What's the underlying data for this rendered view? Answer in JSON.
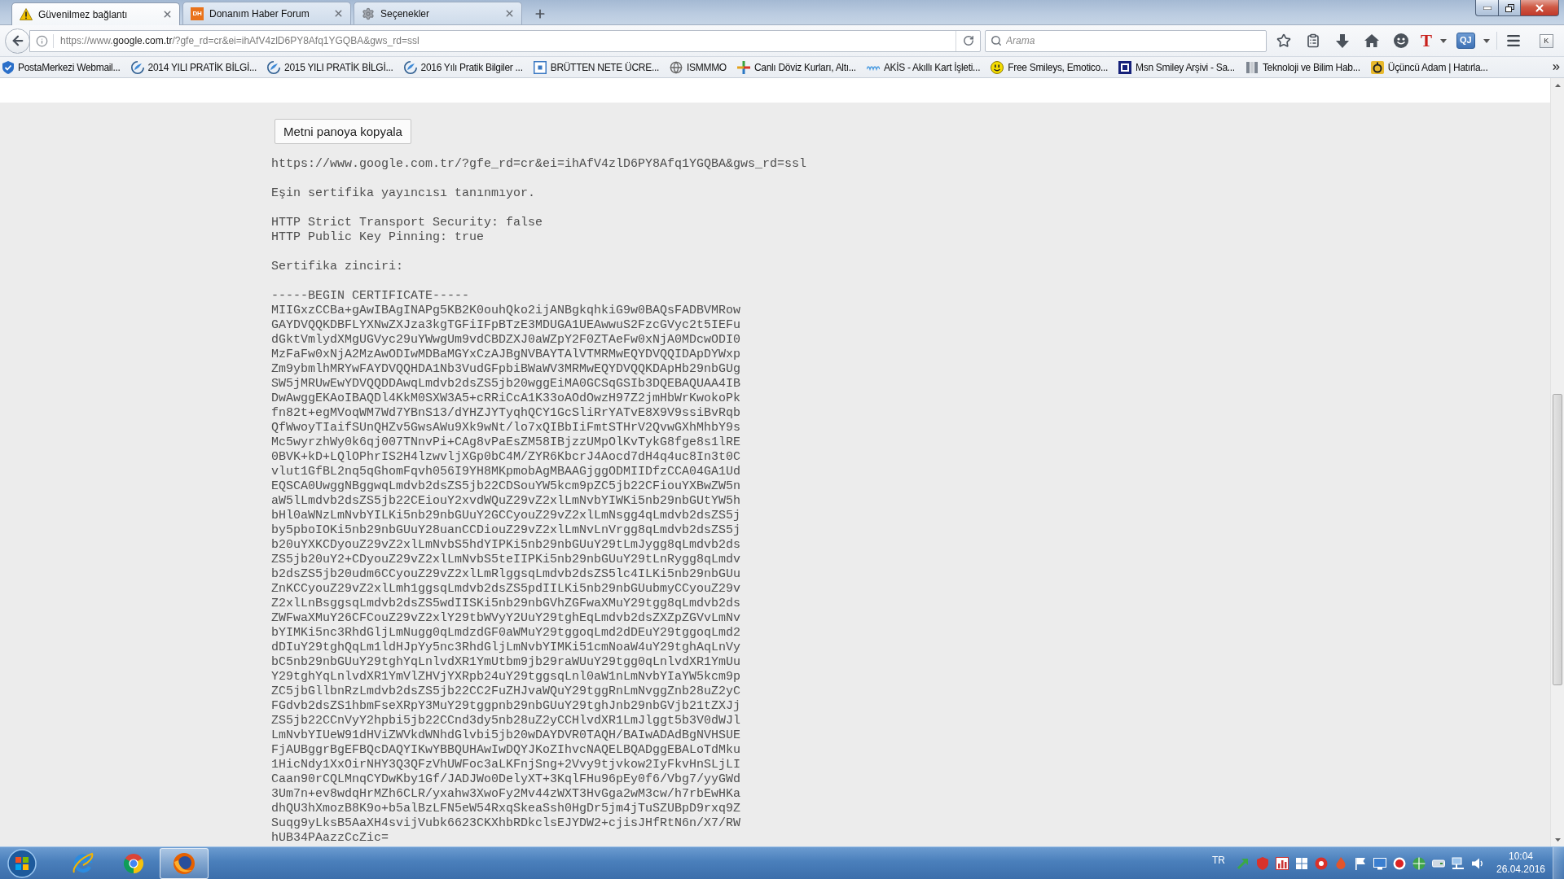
{
  "tabs": [
    {
      "title": "Güvenilmez bağlantı",
      "selected": true,
      "kind": "warning"
    },
    {
      "title": "Donanım Haber Forum",
      "selected": false,
      "kind": "logo",
      "logo_text": "DH"
    },
    {
      "title": "Seçenekler",
      "selected": false,
      "kind": "gear"
    }
  ],
  "address_bar": {
    "url_prefix": "https://www.",
    "url_domain": "google.com.tr",
    "url_path": "/?gfe_rd=cr&ei=ihAfV4zlD6PY8Afq1YGQBA&gws_rd=ssl"
  },
  "search": {
    "placeholder": "Arama"
  },
  "toolbar": {
    "extensions": [
      {
        "kind": "serif",
        "text": "T",
        "menu": true
      },
      {
        "kind": "badge",
        "text": "QJ",
        "menu": true
      }
    ],
    "panel_button": {
      "text": "K"
    }
  },
  "bookmarks": [
    {
      "label": "PostaMerkezi Webmail...",
      "kind": "shield"
    },
    {
      "label": "2014 YILI PRATİK BİLGİ...",
      "kind": "swirl"
    },
    {
      "label": "2015 YILI PRATİK BİLGİ...",
      "kind": "swirl"
    },
    {
      "label": "2016 Yılı Pratik Bilgiler ...",
      "kind": "swirl"
    },
    {
      "label": "BRÜTTEN NETE ÜCRE...",
      "kind": "frame"
    },
    {
      "label": "ISMMMO",
      "kind": "globe"
    },
    {
      "label": "Canlı Döviz Kurları, Altı...",
      "kind": "cross"
    },
    {
      "label": "AKİS - Akıllı Kart İşleti...",
      "kind": "wordmark"
    },
    {
      "label": "Free Smileys, Emotico...",
      "kind": "smiley"
    },
    {
      "label": "Msn Smiley Arşivi - Sa...",
      "kind": "tile"
    },
    {
      "label": "Teknoloji ve Bilim Hab...",
      "kind": "figure"
    },
    {
      "label": "Üçüncü Adam | Hatırla...",
      "kind": "ring"
    }
  ],
  "page": {
    "copy_button": "Metni panoya kopyala",
    "url": "https://www.google.com.tr/?gfe_rd=cr&ei=ihAfV4zlD6PY8Afq1YGQBA&gws_rd=ssl",
    "error": "Eşin sertifika yayıncısı tanınmıyor.",
    "security": [
      "HTTP Strict Transport Security: false",
      "HTTP Public Key Pinning: true"
    ],
    "chain_label": "Sertifika zinciri:",
    "certificate": {
      "begin": "-----BEGIN CERTIFICATE-----",
      "lines": [
        "MIIGxzCCBa+gAwIBAgINAPg5KB2K0ouhQko2ijANBgkqhkiG9w0BAQsFADBVMRow",
        "GAYDVQQKDBFLYXNwZXJza3kgTGFiIFpBTzE3MDUGA1UEAwwuS2FzcGVyc2t5IEFu",
        "dGktVmlydXMgUGVyc29uYWwgUm9vdCBDZXJ0aWZpY2F0ZTAeFw0xNjA0MDcwODI0",
        "MzFaFw0xNjA2MzAwODIwMDBaMGYxCzAJBgNVBAYTAlVTMRMwEQYDVQQIDApDYWxp",
        "Zm9ybmlhMRYwFAYDVQQHDA1Nb3VudGFpbiBWaWV3MRMwEQYDVQQKDApHb29nbGUg",
        "SW5jMRUwEwYDVQQDDAwqLmdvb2dsZS5jb20wggEiMA0GCSqGSIb3DQEBAQUAA4IB",
        "DwAwggEKAoIBAQDl4KkM0SXW3A5+cRRiCcA1K33oAOdOwzH97Z2jmHbWrKwokoPk",
        "fn82t+egMVoqWM7Wd7YBnS13/dYHZJYTyqhQCY1GcSliRrYATvE8X9V9ssiBvRqb",
        "QfWwoyTIaifSUnQHZv5GwsAWu9Xk9wNt/lo7xQIBbIiFmtSTHrV2QvwGXhMhbY9s",
        "Mc5wyrzhWy0k6qj007TNnvPi+CAg8vPaEsZM58IBjzzUMpOlKvTykG8fge8s1lRE",
        "0BVK+kD+LQlOPhrIS2H4lzwvljXGp0bC4M/ZYR6KbcrJ4Aocd7dH4q4uc8In3t0C",
        "vlut1GfBL2nq5qGhomFqvh056I9YH8MKpmobAgMBAAGjggODMIIDfzCCA04GA1Ud",
        "EQSCA0UwggNBggwqLmdvb2dsZS5jb22CDSouYW5kcm9pZC5jb22CFiouYXBwZW5n",
        "aW5lLmdvb2dsZS5jb22CEiouY2xvdWQuZ29vZ2xlLmNvbYIWKi5nb29nbGUtYW5h",
        "bHl0aWNzLmNvbYILKi5nb29nbGUuY2GCCyouZ29vZ2xlLmNsgg4qLmdvb2dsZS5j",
        "by5pboIOKi5nb29nbGUuY28uanCCDiouZ29vZ2xlLmNvLnVrgg8qLmdvb2dsZS5j",
        "b20uYXKCDyouZ29vZ2xlLmNvbS5hdYIPKi5nb29nbGUuY29tLmJygg8qLmdvb2ds",
        "ZS5jb20uY2+CDyouZ29vZ2xlLmNvbS5teIIPKi5nb29nbGUuY29tLnRygg8qLmdv",
        "b2dsZS5jb20udm6CCyouZ29vZ2xlLmRlggsqLmdvb2dsZS5lc4ILKi5nb29nbGUu",
        "ZnKCCyouZ29vZ2xlLmh1ggsqLmdvb2dsZS5pdIILKi5nb29nbGUubmyCCyouZ29v",
        "Z2xlLnBsggsqLmdvb2dsZS5wdIISKi5nb29nbGVhZGFwaXMuY29tgg8qLmdvb2ds",
        "ZWFwaXMuY26CFCouZ29vZ2xlY29tbWVyY2UuY29tghEqLmdvb2dsZXZpZGVvLmNv",
        "bYIMKi5nc3RhdGljLmNugg0qLmdzdGF0aWMuY29tggoqLmd2dDEuY29tggoqLmd2",
        "dDIuY29tghQqLm1ldHJpYy5nc3RhdGljLmNvbYIMKi51cmNoaW4uY29tghAqLnVy",
        "bC5nb29nbGUuY29tghYqLnlvdXR1YmUtbm9jb29raWUuY29tgg0qLnlvdXR1YmUu",
        "Y29tghYqLnlvdXR1YmVlZHVjYXRpb24uY29tggsqLnl0aW1nLmNvbYIaYW5kcm9p",
        "ZC5jbGllbnRzLmdvb2dsZS5jb22CC2FuZHJvaWQuY29tggRnLmNvggZnb28uZ2yC",
        "FGdvb2dsZS1hbmFseXRpY3MuY29tggpnb29nbGUuY29tghJnb29nbGVjb21tZXJj",
        "ZS5jb22CCnVyY2hpbi5jb22CCnd3dy5nb28uZ2yCCHlvdXR1LmJlggt5b3V0dWJl",
        "LmNvbYIUeW91dHViZWVkdWNhdGlvbi5jb20wDAYDVR0TAQH/BAIwADAdBgNVHSUE",
        "FjAUBggrBgEFBQcDAQYIKwYBBQUHAwIwDQYJKoZIhvcNAQELBQADggEBALoTdMku",
        "1HicNdy1XxOirNHY3Q3QFzVhUWFoc3aLKFnjSng+2Vvy9tjvkow2IyFkvHnSLjLI",
        "Caan90rCQLMnqCYDwKby1Gf/JADJWo0DelyXT+3KqlFHu96pEy0f6/Vbg7/yyGWd",
        "3Um7n+ev8wdqHrMZh6CLR/yxahw3XwoFy2Mv44zWXT3HvGga2wM3cw/h7rbEwHKa",
        "dhQU3hXmozB8K9o+b5alBzLFN5eW54RxqSkeaSsh0HgDr5jm4jTuSZUBpD9rxq9Z",
        "Suqg9yLksB5AaXH4svijVubk6623CKXhbRDkclsEJYDW2+cjisJHfRtN6n/X7/RW",
        "hUB34PAazzCcZic="
      ]
    }
  },
  "taskbar": {
    "apps": [
      {
        "kind": "e-logo",
        "active": false
      },
      {
        "kind": "wheel",
        "active": false
      },
      {
        "kind": "fox",
        "active": true
      }
    ],
    "language": "TR",
    "time": "10:04",
    "date": "26.04.2016"
  }
}
